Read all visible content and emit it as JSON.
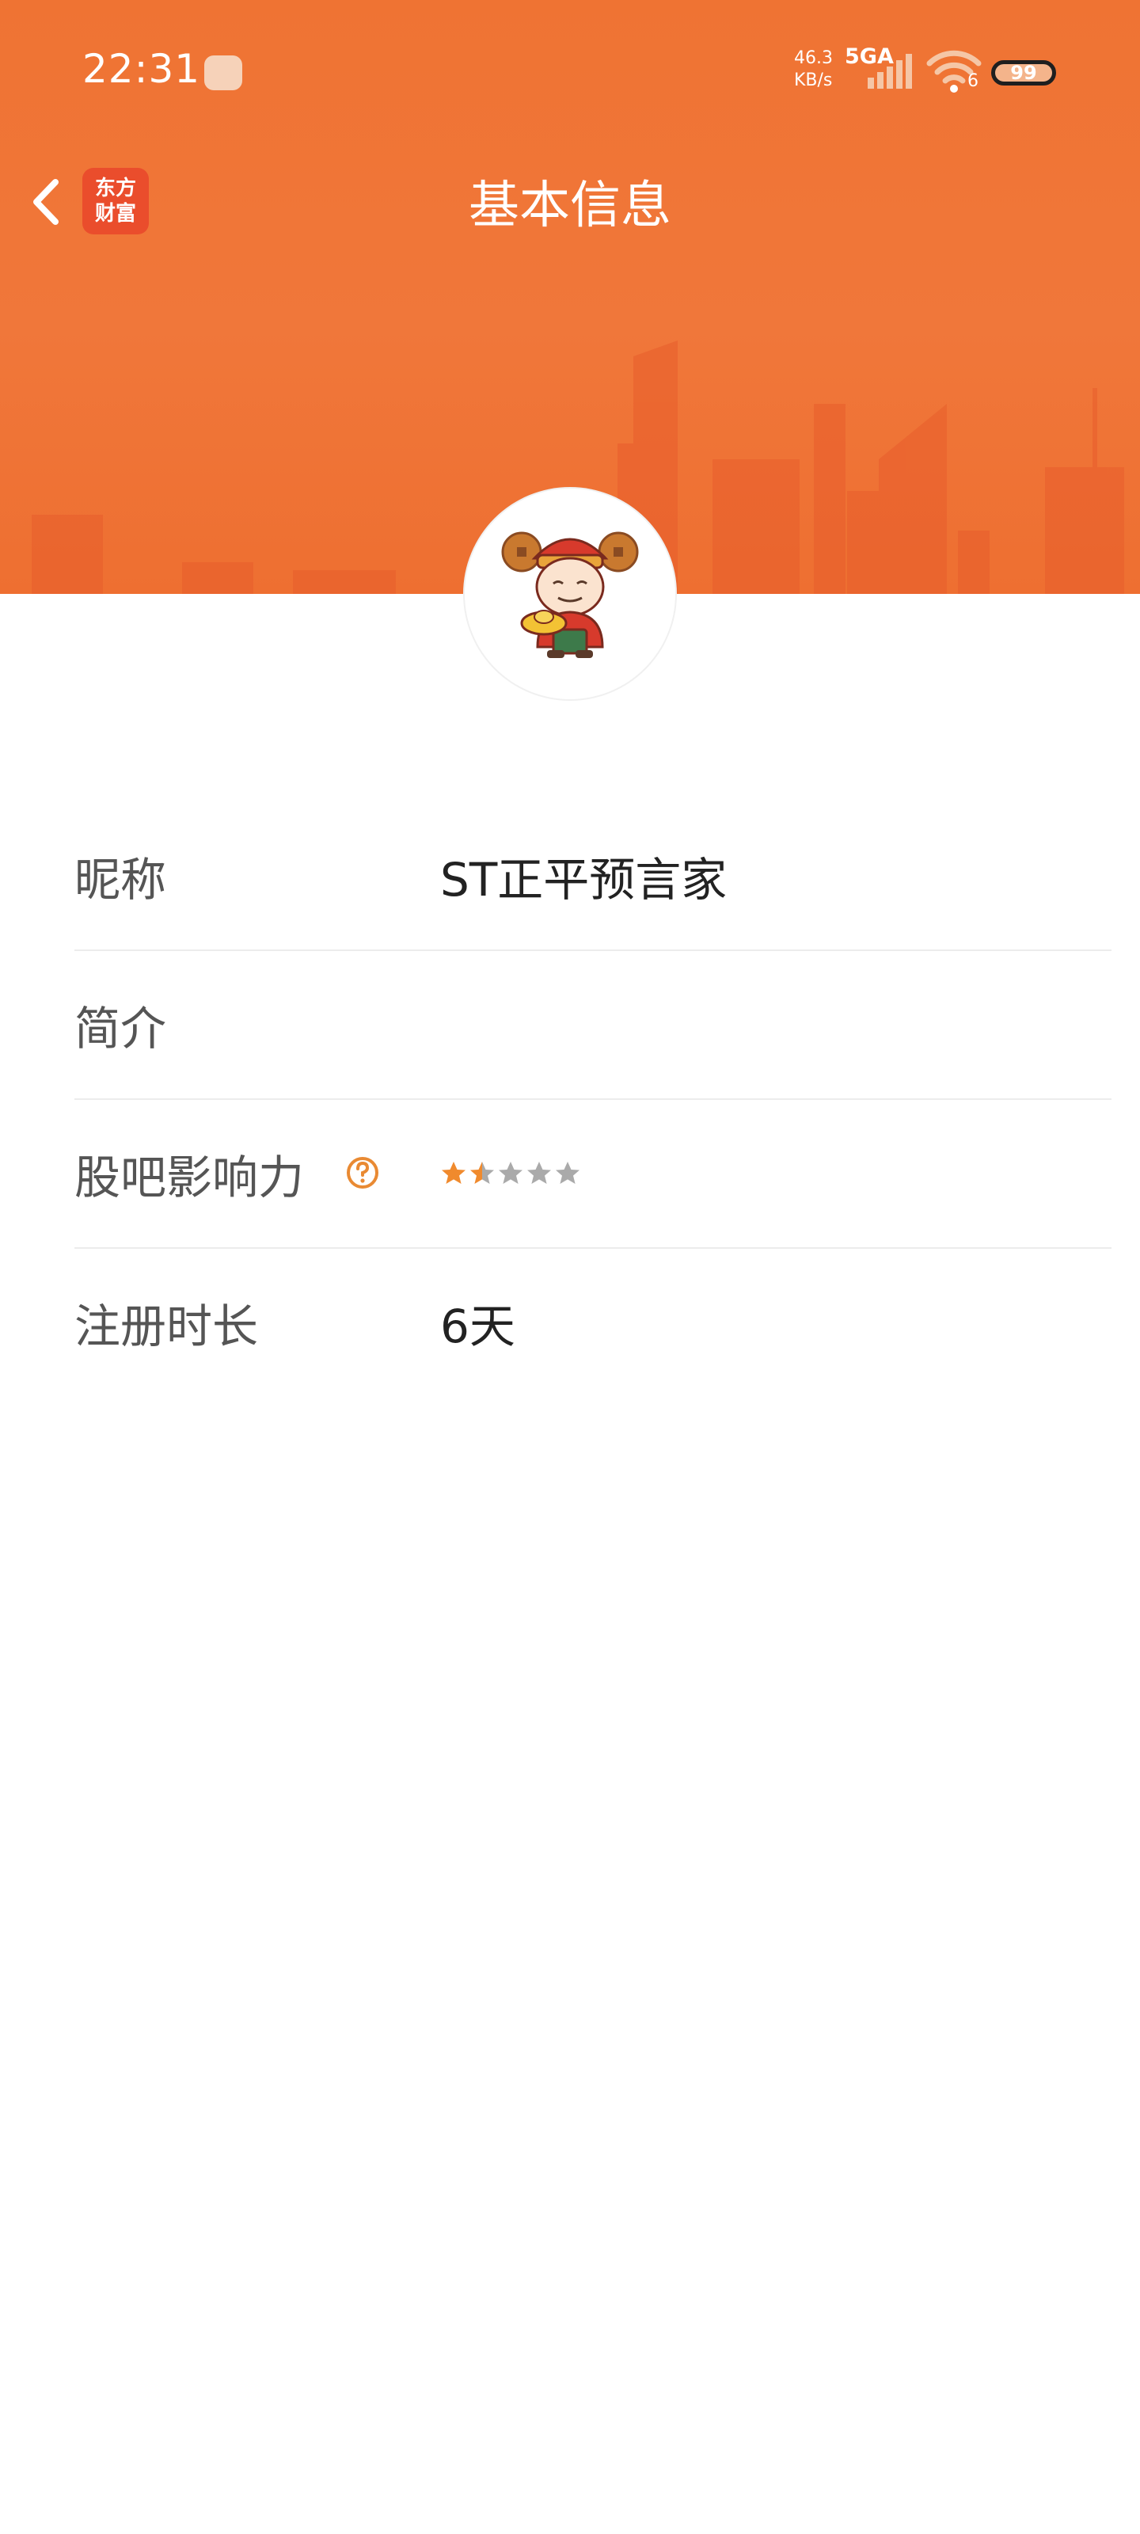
{
  "status_bar": {
    "time": "22:31",
    "net_speed_value": "46.3",
    "net_speed_unit": "KB/s",
    "network_type": "5GA",
    "wifi_level": "6",
    "battery": "99"
  },
  "header": {
    "title": "基本信息",
    "logo_line1": "东方",
    "logo_line2": "财富"
  },
  "profile": {
    "rows": [
      {
        "label": "昵称",
        "value": "ST正平预言家"
      },
      {
        "label": "简介",
        "value": ""
      },
      {
        "label": "股吧影响力",
        "rating": 1.5,
        "max_rating": 5
      },
      {
        "label": "注册时长",
        "value": "6天"
      }
    ]
  },
  "colors": {
    "header_bg": "#ef7333",
    "accent": "#e98a33",
    "star_filled": "#f08a2d",
    "star_empty": "#aaaaaa"
  },
  "icons": {
    "back": "chevron-left-icon",
    "help": "question-circle-icon",
    "signal": "cell-signal-icon",
    "wifi": "wifi-icon"
  }
}
